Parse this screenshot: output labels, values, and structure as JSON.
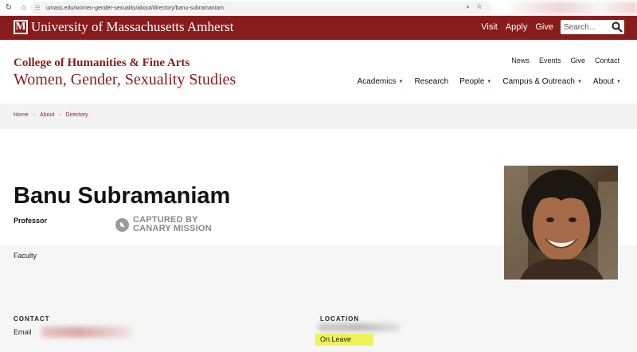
{
  "browser": {
    "url": "umass.edu/women-gender-sexuality/about/directory/banu-subramaniam"
  },
  "header": {
    "logo_letter": "M",
    "university": "University of Massachusetts Amherst",
    "utility_links": [
      "Visit",
      "Apply",
      "Give"
    ],
    "search_placeholder": "Search..."
  },
  "site": {
    "college": "College of Humanities & Fine Arts",
    "department": "Women, Gender, Sexuality Studies",
    "secondary_nav": [
      "News",
      "Events",
      "Give",
      "Contact"
    ],
    "main_nav": [
      {
        "label": "Academics",
        "has_dropdown": true
      },
      {
        "label": "Research",
        "has_dropdown": false
      },
      {
        "label": "People",
        "has_dropdown": true
      },
      {
        "label": "Campus & Outreach",
        "has_dropdown": true
      },
      {
        "label": "About",
        "has_dropdown": true
      }
    ]
  },
  "breadcrumb": [
    "Home",
    "About",
    "Directory"
  ],
  "profile": {
    "name": "Banu Subramaniam",
    "title": "Professor",
    "canary_line1": "CAPTURED BY",
    "canary_line2": "CANARY MISSION",
    "category": "Faculty",
    "contact_heading": "CONTACT",
    "email_label": "Email",
    "location_heading": "LOCATION",
    "location_status": "On Leave"
  },
  "colors": {
    "brand": "#881c1c",
    "highlight": "#eef255"
  }
}
